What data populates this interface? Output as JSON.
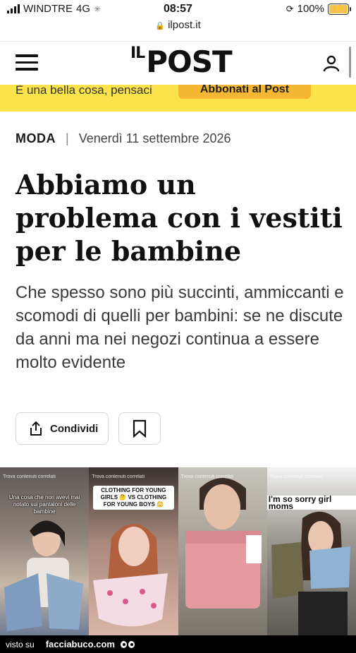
{
  "status_bar": {
    "carrier": "WINDTRE",
    "network": "4G",
    "time": "08:57",
    "url": "ilpost.it",
    "battery": "100%"
  },
  "header": {
    "logo_prefix": "IL",
    "logo_main": "POST",
    "menu_icon": "hamburger-icon",
    "account_icon": "user-icon"
  },
  "banner": {
    "text": "È una bella cosa, pensaci",
    "cta_label": "Abbonati al Post",
    "background": "#fbe44b",
    "button_color": "#f5b731"
  },
  "article": {
    "category": "MODA",
    "date": "Venerdì 11 settembre 2026",
    "title": "Abbiamo un problema con i vestiti per le bambine",
    "subtitle": "Che spesso sono più succinti, ammiccanti e scomodi di quelli per bambini: se ne discute da anni ma nei negozi continua a essere molto evidente",
    "share_label": "Condividi",
    "bookmark_icon": "bookmark-icon"
  },
  "image_strip": {
    "panels": [
      {
        "tag": "Trova contenuti correlati",
        "caption": "Una cosa che non avevi mai notato sui pantaloni delle bambine",
        "bg": "#7a6f68"
      },
      {
        "tag": "Trova contenuti correlati",
        "caption": "CLOTHING FOR YOUNG GIRLS 🤔 VS CLOTHING FOR YOUNG BOYS 😳",
        "bg": "#b78a7c"
      },
      {
        "tag": "Trova contenuti correlati",
        "caption": "",
        "bg": "#8c8a7f"
      },
      {
        "tag": "Trova contenuti correlati",
        "caption": "I'm so sorry girl moms",
        "bg": "#6e6a64"
      }
    ]
  },
  "footer": {
    "prefix": "visto su",
    "brand": "facciabuco.com"
  }
}
